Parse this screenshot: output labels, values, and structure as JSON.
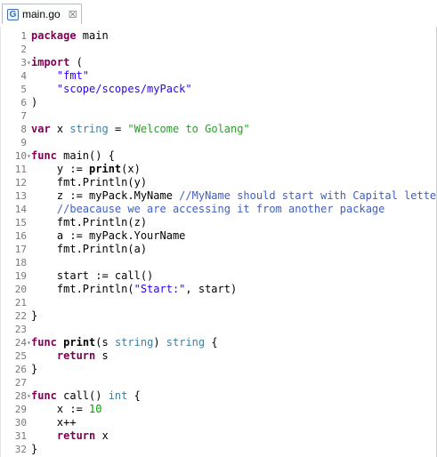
{
  "tab": {
    "title": "main.go",
    "close": "☒"
  },
  "lines": [
    {
      "n": "1",
      "text": "package main"
    },
    {
      "n": "2",
      "text": ""
    },
    {
      "n": "3",
      "text": "import ("
    },
    {
      "n": "4",
      "text": "    \"fmt\""
    },
    {
      "n": "5",
      "text": "    \"scope/scopes/myPack\""
    },
    {
      "n": "6",
      "text": ")"
    },
    {
      "n": "7",
      "text": ""
    },
    {
      "n": "8",
      "text": "var x string = \"Welcome to Golang\""
    },
    {
      "n": "9",
      "text": ""
    },
    {
      "n": "10",
      "text": "func main() {"
    },
    {
      "n": "11",
      "text": "    y := print(x)"
    },
    {
      "n": "12",
      "text": "    fmt.Println(y)"
    },
    {
      "n": "13",
      "text": "    z := myPack.MyName //MyName should start with Capital letter"
    },
    {
      "n": "14",
      "text": "    //beacause we are accessing it from another package"
    },
    {
      "n": "15",
      "text": "    fmt.Println(z)"
    },
    {
      "n": "16",
      "text": "    a := myPack.YourName"
    },
    {
      "n": "17",
      "text": "    fmt.Println(a)"
    },
    {
      "n": "18",
      "text": ""
    },
    {
      "n": "19",
      "text": "    start := call()"
    },
    {
      "n": "20",
      "text": "    fmt.Println(\"Start:\", start)"
    },
    {
      "n": "21",
      "text": ""
    },
    {
      "n": "22",
      "text": "}"
    },
    {
      "n": "23",
      "text": ""
    },
    {
      "n": "24",
      "text": "func print(s string) string {"
    },
    {
      "n": "25",
      "text": "    return s"
    },
    {
      "n": "26",
      "text": "}"
    },
    {
      "n": "27",
      "text": ""
    },
    {
      "n": "28",
      "text": "func call() int {"
    },
    {
      "n": "29",
      "text": "    x := 10"
    },
    {
      "n": "30",
      "text": "    x++"
    },
    {
      "n": "31",
      "text": "    return x"
    },
    {
      "n": "32",
      "text": "}"
    }
  ]
}
